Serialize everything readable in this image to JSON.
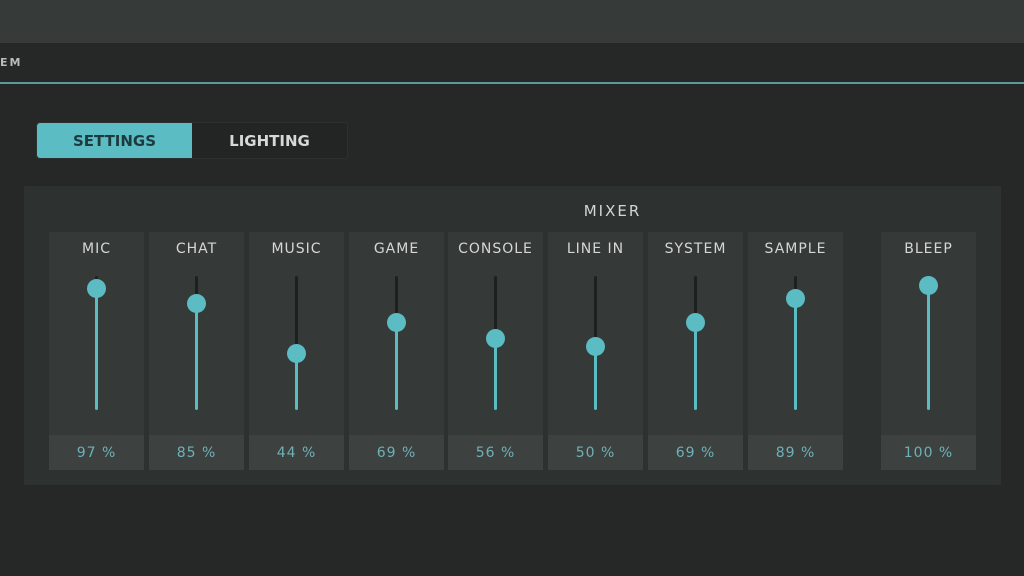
{
  "nav": {
    "partial_item": "EM"
  },
  "tabs": [
    {
      "label": "SETTINGS",
      "active": true
    },
    {
      "label": "LIGHTING",
      "active": false
    }
  ],
  "mixer": {
    "title": "MIXER",
    "accent_color": "#5bbcc4",
    "channels": [
      {
        "label": "MIC",
        "value": 97,
        "display": "97 %"
      },
      {
        "label": "CHAT",
        "value": 85,
        "display": "85 %"
      },
      {
        "label": "MUSIC",
        "value": 44,
        "display": "44 %"
      },
      {
        "label": "GAME",
        "value": 69,
        "display": "69 %"
      },
      {
        "label": "CONSOLE",
        "value": 56,
        "display": "56 %"
      },
      {
        "label": "LINE IN",
        "value": 50,
        "display": "50 %"
      },
      {
        "label": "SYSTEM",
        "value": 69,
        "display": "69 %"
      },
      {
        "label": "SAMPLE",
        "value": 89,
        "display": "89 %"
      },
      {
        "label": "BLEEP",
        "value": 100,
        "display": "100 %"
      }
    ]
  }
}
